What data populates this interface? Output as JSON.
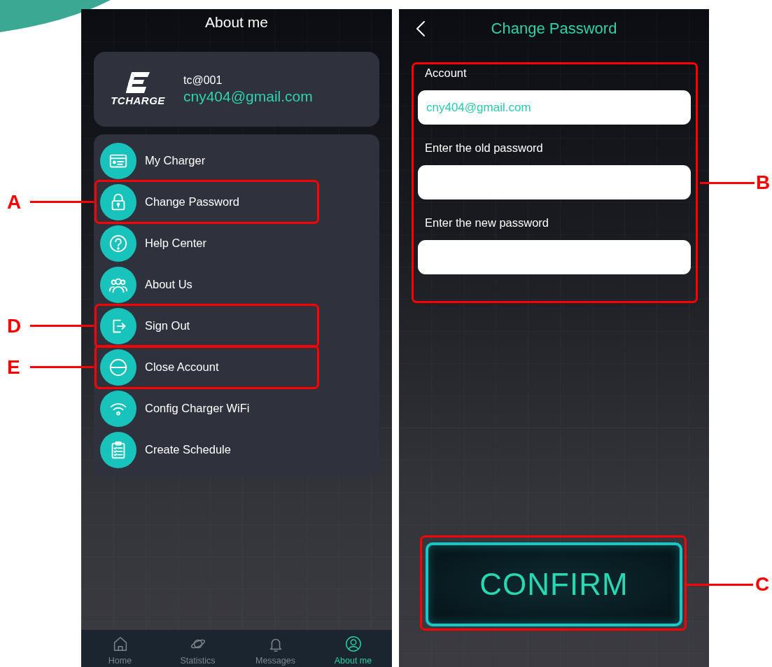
{
  "about_screen": {
    "title": "About me",
    "profile": {
      "logo_text": "TCHARGE",
      "username": "tc@001",
      "email": "cny404@gmail.com"
    },
    "menu": [
      {
        "label": "My Charger"
      },
      {
        "label": "Change Password",
        "callout": "A"
      },
      {
        "label": "Help Center"
      },
      {
        "label": "About Us"
      },
      {
        "label": "Sign Out",
        "callout": "D"
      },
      {
        "label": "Close Account",
        "callout": "E"
      },
      {
        "label": "Config Charger WiFi"
      },
      {
        "label": "Create Schedule"
      }
    ],
    "tab_bar": [
      {
        "label": "Home",
        "selected": false
      },
      {
        "label": "Statistics",
        "selected": false
      },
      {
        "label": "Messages",
        "selected": false
      },
      {
        "label": "About me",
        "selected": true
      }
    ]
  },
  "password_screen": {
    "title": "Change Password",
    "fields_callout": "B",
    "fields": [
      {
        "label": "Account",
        "value": "cny404@gmail.com"
      },
      {
        "label": "Enter the old password"
      },
      {
        "label": "Enter the new password"
      }
    ],
    "button": {
      "label": "CONFIRM",
      "callout": "C"
    }
  }
}
